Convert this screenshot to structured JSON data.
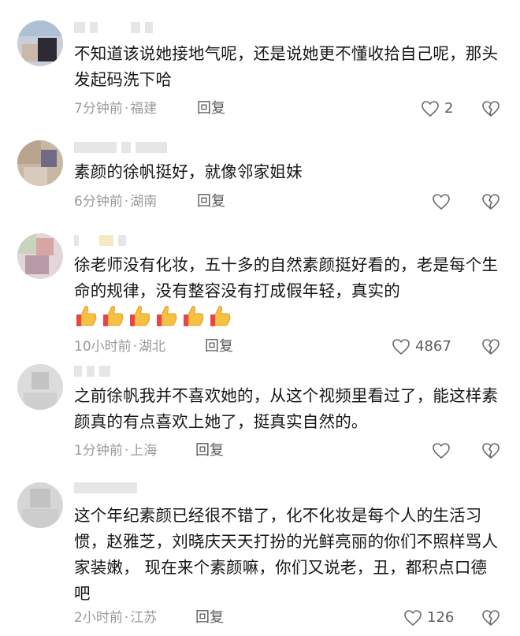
{
  "comments": [
    {
      "text": "不知道该说她接地气呢，还是说她更不懂收拾自己呢，那头发起码洗下哈",
      "time": "7分钟前",
      "location": "福建",
      "reply": "回复",
      "likes": "2"
    },
    {
      "text": "素颜的徐帆挺好，就像邻家姐妹",
      "time": "6分钟前",
      "location": "湖南",
      "reply": "回复",
      "likes": ""
    },
    {
      "text": "徐老师没有化妆，五十多的自然素颜挺好看的，老是每个生命的规律，没有整容没有打成假年轻，真实的",
      "emoji": "thumbs-up x6",
      "time": "10小时前",
      "location": "湖北",
      "reply": "回复",
      "likes": "4867"
    },
    {
      "text": "之前徐帆我并不喜欢她的，从这个视频里看过了，能这样素颜真的有点喜欢上她了，挺真实自然的。",
      "time": "1分钟前",
      "location": "上海",
      "reply": "回复",
      "likes": ""
    },
    {
      "text": "这个年纪素颜已经很不错了，化不化妆是每个人的生活习惯，赵雅芝，刘晓庆天天打扮的光鲜亮丽的你们不照样骂人家装嫩， 现在来个素颜嘛，你们又说老，丑，都积点口德吧",
      "time": "2小时前",
      "location": "江苏",
      "reply": "回复",
      "likes": "126"
    }
  ],
  "icons": {
    "like": "heart-outline-icon",
    "dislike": "broken-heart-icon",
    "emoji": "thumbs-up-emoji"
  },
  "colors": {
    "text": "#161616",
    "meta": "#9a9a9a",
    "icon": "#6a6a6a"
  }
}
